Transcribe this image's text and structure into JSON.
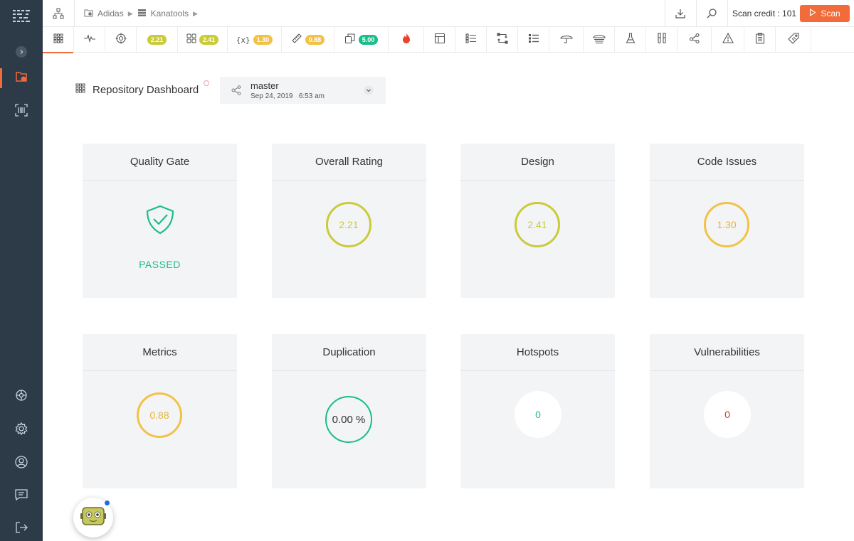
{
  "colors": {
    "accent": "#f26b3a",
    "rail_bg": "#2d3a47",
    "card_bg": "#f3f4f6",
    "passed": "#1dbc8a",
    "rating_yellowgreen": "#c9cb3a",
    "rating_amber": "#f2c247",
    "rating_green": "#1dbc8a",
    "vuln_red": "#c0392b"
  },
  "breadcrumb": {
    "org": "Adidas",
    "repo": "Kanatools"
  },
  "header": {
    "scan_credit": "Scan credit : 101",
    "scan_label": "Scan"
  },
  "tabs": {
    "pill_1": "2.21",
    "pill_2": "2.41",
    "pill_3": "1.30",
    "pill_4": "0.88",
    "pill_5": "5.00"
  },
  "page": {
    "title": "Repository Dashboard"
  },
  "branch": {
    "name": "master",
    "date": "Sep 24, 2019",
    "time": "6:53 am"
  },
  "cards": {
    "quality_gate": {
      "title": "Quality Gate",
      "status": "PASSED"
    },
    "overall_rating": {
      "title": "Overall Rating",
      "value": "2.21"
    },
    "design": {
      "title": "Design",
      "value": "2.41"
    },
    "code_issues": {
      "title": "Code Issues",
      "value": "1.30"
    },
    "metrics": {
      "title": "Metrics",
      "value": "0.88"
    },
    "duplication": {
      "title": "Duplication",
      "value": "0.00 %"
    },
    "hotspots": {
      "title": "Hotspots",
      "value": "0"
    },
    "vulnerabilities": {
      "title": "Vulnerabilities",
      "value": "0"
    }
  },
  "icons": {
    "rail": [
      "app-logo-icon",
      "expand-chevron-icon",
      "repository-icon",
      "barcode-icon",
      "integrations-icon",
      "settings-icon",
      "user-icon",
      "chat-icon",
      "logout-icon"
    ],
    "header": [
      "hierarchy-icon",
      "folder-icon",
      "repo-icon",
      "download-icon",
      "search-icon",
      "play-icon"
    ],
    "tabs": [
      "dashboard-grid-icon",
      "pulse-icon",
      "target-icon",
      "components-icon",
      "variable-icon",
      "ruler-icon",
      "copy-icon",
      "fire-icon",
      "layout-icon",
      "list-icon",
      "flow-icon",
      "checklist-icon",
      "umbrella-icon",
      "layers-icon",
      "flask-icon",
      "tubes-icon",
      "share-icon",
      "warning-icon",
      "clipboard-icon",
      "tag-icon"
    ]
  }
}
